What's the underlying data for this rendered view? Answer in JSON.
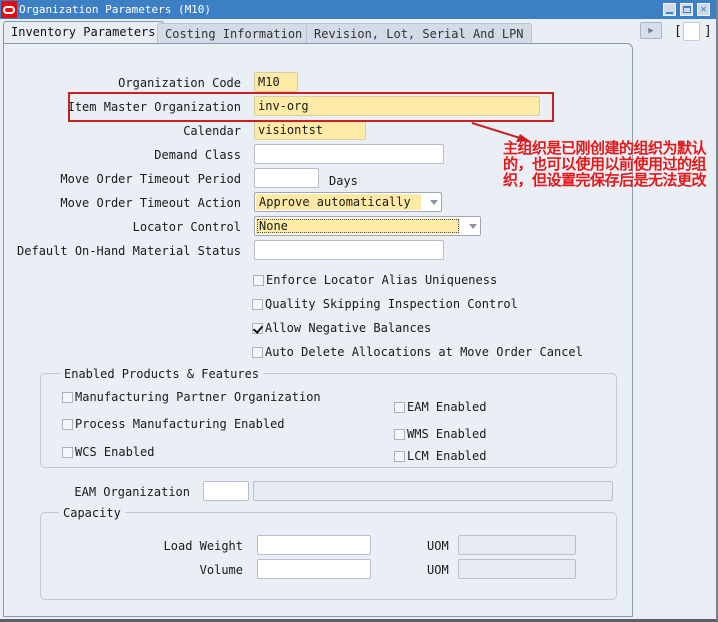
{
  "window": {
    "title": "Organization Parameters (M10)",
    "icons": {
      "logo": "oracle-logo-icon",
      "minimize": "minimize-icon",
      "maximize": "maximize-icon",
      "close": "close-icon"
    }
  },
  "tabs": [
    {
      "label": "Inventory Parameters",
      "active": true
    },
    {
      "label": "Costing Information",
      "active": false
    },
    {
      "label": "Revision, Lot, Serial And LPN",
      "active": false
    }
  ],
  "tab_controls": {
    "scroll_icon": "arrow-right-icon",
    "bracket_left": "[",
    "bracket_right": "]"
  },
  "form": {
    "organization_code": {
      "label": "Organization Code",
      "value": "M10"
    },
    "item_master_organization": {
      "label": "Item Master Organization",
      "value": "inv-org"
    },
    "calendar": {
      "label": "Calendar",
      "value": "visiontst"
    },
    "demand_class": {
      "label": "Demand Class",
      "value": ""
    },
    "move_order_timeout_period": {
      "label": "Move Order Timeout Period",
      "value": "",
      "unit": "Days"
    },
    "move_order_timeout_action": {
      "label": "Move Order Timeout Action",
      "value": "Approve automatically"
    },
    "locator_control": {
      "label": "Locator Control",
      "value": "None"
    },
    "default_onhand_material_status": {
      "label": "Default On-Hand Material Status",
      "value": ""
    },
    "checkboxes": [
      {
        "label": "Enforce Locator Alias Uniqueness",
        "checked": false
      },
      {
        "label": "Quality Skipping Inspection Control",
        "checked": false
      },
      {
        "label": "Allow Negative Balances",
        "checked": true
      },
      {
        "label": "Auto Delete Allocations at Move Order Cancel",
        "checked": false
      }
    ]
  },
  "enabled_products": {
    "title": "Enabled Products & Features",
    "left": [
      {
        "label": "Manufacturing Partner Organization",
        "checked": false
      },
      {
        "label": "Process Manufacturing Enabled",
        "checked": false
      },
      {
        "label": "WCS Enabled",
        "checked": false
      }
    ],
    "right": [
      {
        "label": "EAM Enabled",
        "checked": false
      },
      {
        "label": "WMS Enabled",
        "checked": false
      },
      {
        "label": "LCM Enabled",
        "checked": false
      }
    ]
  },
  "eam_organization": {
    "label": "EAM Organization",
    "code": "",
    "name": ""
  },
  "capacity": {
    "title": "Capacity",
    "load_weight": {
      "label": "Load Weight",
      "value": "",
      "uom_label": "UOM",
      "uom": ""
    },
    "volume": {
      "label": "Volume",
      "value": "",
      "uom_label": "UOM",
      "uom": ""
    }
  },
  "annotation": {
    "text": "主组织是已刚创建的组织为默认的，也可以使用以前使用过的组织，但设置完保存后是无法更改",
    "color": "#e21a1a"
  }
}
